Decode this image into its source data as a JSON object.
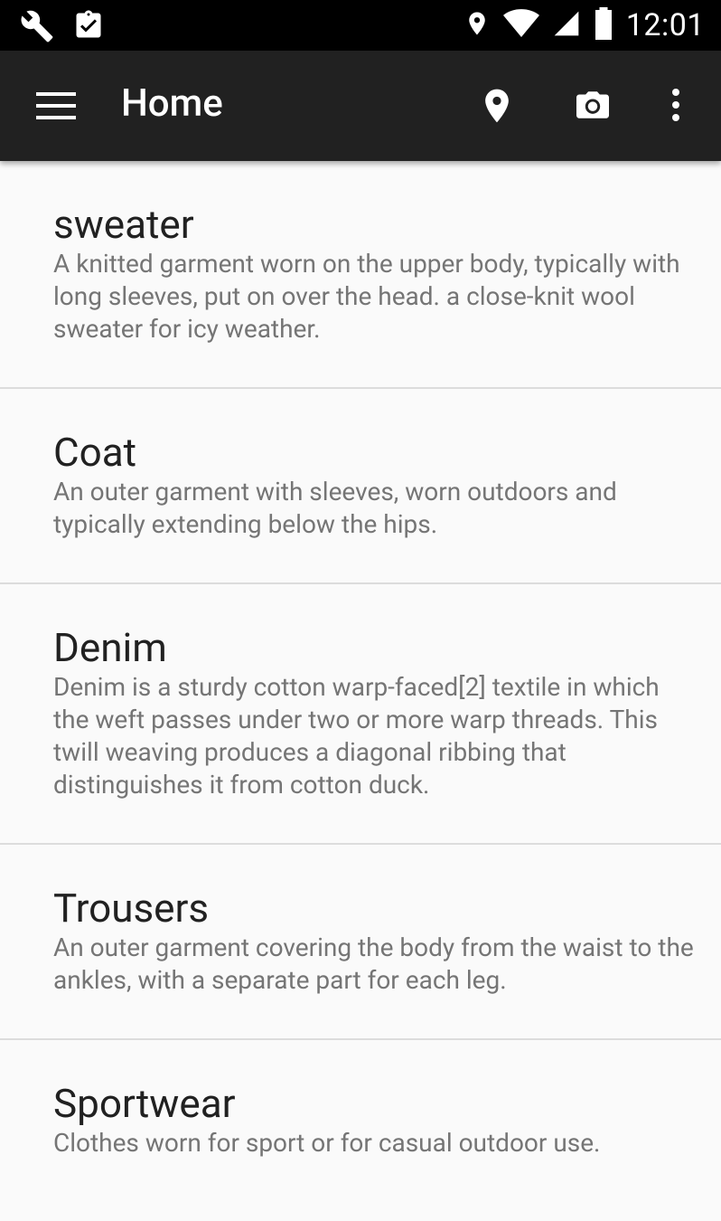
{
  "status_bar": {
    "time": "12:01",
    "left_icons": [
      "wrench-icon",
      "clipboard-check-icon"
    ],
    "right_icons": [
      "location-icon",
      "wifi-icon",
      "signal-icon",
      "battery-icon"
    ]
  },
  "app_bar": {
    "title": "Home",
    "actions": [
      "location-icon",
      "camera-icon",
      "more-vert-icon"
    ]
  },
  "items": [
    {
      "name": "sweater",
      "description": "A knitted garment worn on the upper body, typically with long sleeves, put on over the head. a close-knit wool sweater for icy weather."
    },
    {
      "name": "Coat",
      "description": "An outer garment with sleeves, worn outdoors and typically extending below the hips."
    },
    {
      "name": "Denim",
      "description": "Denim is a sturdy cotton warp-faced[2] textile in which the weft passes under two or more warp threads. This twill weaving produces a diagonal ribbing that distinguishes it from cotton duck."
    },
    {
      "name": "Trousers",
      "description": "An outer garment covering the body from the waist to the ankles, with a separate part for each leg."
    },
    {
      "name": "Sportwear",
      "description": "Clothes worn for sport or for casual outdoor use."
    }
  ]
}
